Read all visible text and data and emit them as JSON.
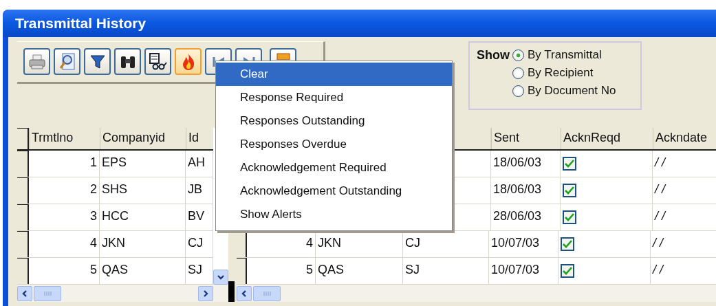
{
  "window": {
    "title": "Transmittal History"
  },
  "toolbar": [
    {
      "kind": "print",
      "selected": false
    },
    {
      "kind": "preview",
      "selected": false
    },
    {
      "kind": "filter",
      "selected": false
    },
    {
      "kind": "find",
      "selected": false
    },
    {
      "kind": "view",
      "selected": false
    },
    {
      "kind": "alerts",
      "selected": true
    },
    {
      "kind": "first",
      "selected": false
    },
    {
      "kind": "last",
      "selected": false
    },
    {
      "kind": "close",
      "selected": false
    }
  ],
  "show": {
    "label": "Show",
    "options": [
      {
        "label": "By Transmittal",
        "selected": true
      },
      {
        "label": "By Recipient",
        "selected": false
      },
      {
        "label": "By Document No",
        "selected": false
      }
    ]
  },
  "menu": {
    "items": [
      {
        "label": "Clear",
        "selected": true
      },
      {
        "label": "Response Required",
        "selected": false
      },
      {
        "label": "Responses Outstanding",
        "selected": false
      },
      {
        "label": "Responses Overdue",
        "selected": false
      },
      {
        "label": "Acknowledgement Required",
        "selected": false
      },
      {
        "label": "Acknowledgement Outstanding",
        "selected": false
      },
      {
        "label": "Show Alerts",
        "selected": false
      }
    ]
  },
  "left_grid": {
    "columns": [
      "Trmtlno",
      "Companyid",
      "Id"
    ],
    "rows": [
      {
        "trmtlno": "1",
        "companyid": "EPS",
        "id": "AH"
      },
      {
        "trmtlno": "2",
        "companyid": "SHS",
        "id": "JB"
      },
      {
        "trmtlno": "3",
        "companyid": "HCC",
        "id": "BV"
      },
      {
        "trmtlno": "4",
        "companyid": "JKN",
        "id": "CJ"
      },
      {
        "trmtlno": "5",
        "companyid": "QAS",
        "id": "SJ"
      }
    ]
  },
  "right_grid": {
    "columns": [
      "Sent",
      "AcknReqd",
      "Ackndate"
    ],
    "rows": [
      {
        "sent": "18/06/03",
        "ackn_reqd": true,
        "ackndate": "/ /"
      },
      {
        "sent": "18/06/03",
        "ackn_reqd": true,
        "ackndate": "/ /"
      },
      {
        "sent": "28/06/03",
        "ackn_reqd": true,
        "ackndate": "/ /"
      },
      {
        "trmtlno": "4",
        "companyid": "JKN",
        "id": "CJ",
        "sent": "10/07/03",
        "ackn_reqd": true,
        "ackndate": "/ /"
      },
      {
        "trmtlno": "5",
        "companyid": "QAS",
        "id": "SJ",
        "sent": "10/07/03",
        "ackn_reqd": true,
        "ackndate": "/ /"
      }
    ]
  }
}
